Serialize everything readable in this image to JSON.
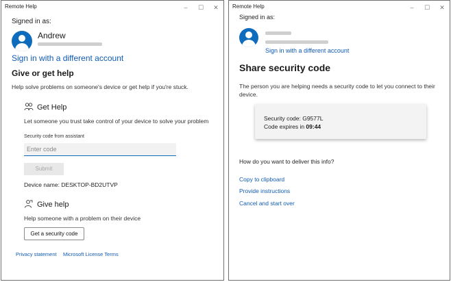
{
  "left_window": {
    "title": "Remote Help",
    "signed_in_label": "Signed in as:",
    "user_name": "Andrew",
    "switch_account_link": "Sign in with a different account",
    "give_or_get_heading": "Give or get help",
    "give_or_get_desc": "Help solve problems on someone's device or get help if you're stuck.",
    "get_help": {
      "heading": "Get Help",
      "desc": "Let someone you trust take control of your device to solve your problem",
      "code_label": "Security code from assistant",
      "code_placeholder": "Enter code",
      "submit_label": "Submit",
      "device_name": "Device name: DESKTOP-BD2UTVP"
    },
    "give_help": {
      "heading": "Give help",
      "desc": "Help someone with a problem on their device",
      "button_label": "Get a security code"
    },
    "footer": {
      "privacy": "Privacy statement",
      "license": "Microsoft License Terms"
    }
  },
  "right_window": {
    "title": "Remote Help",
    "signed_in_label": "Signed in as:",
    "switch_account_link": "Sign in with a different account",
    "heading": "Share security code",
    "desc": "The person you are helping needs a security code to let you connect to their device.",
    "code_card": {
      "code_line": "Security code: G9577L",
      "expires_prefix": "Code expires in ",
      "expires_time": "09:44"
    },
    "deliver_question": "How do you want to deliver this info?",
    "options": {
      "copy": "Copy to clipboard",
      "instructions": "Provide instructions",
      "cancel": "Cancel and start over"
    }
  },
  "window_controls": {
    "minimize": "–",
    "maximize": "☐",
    "close": "✕"
  },
  "colors": {
    "accent": "#0f6cbd",
    "link": "#0f5ab4"
  }
}
